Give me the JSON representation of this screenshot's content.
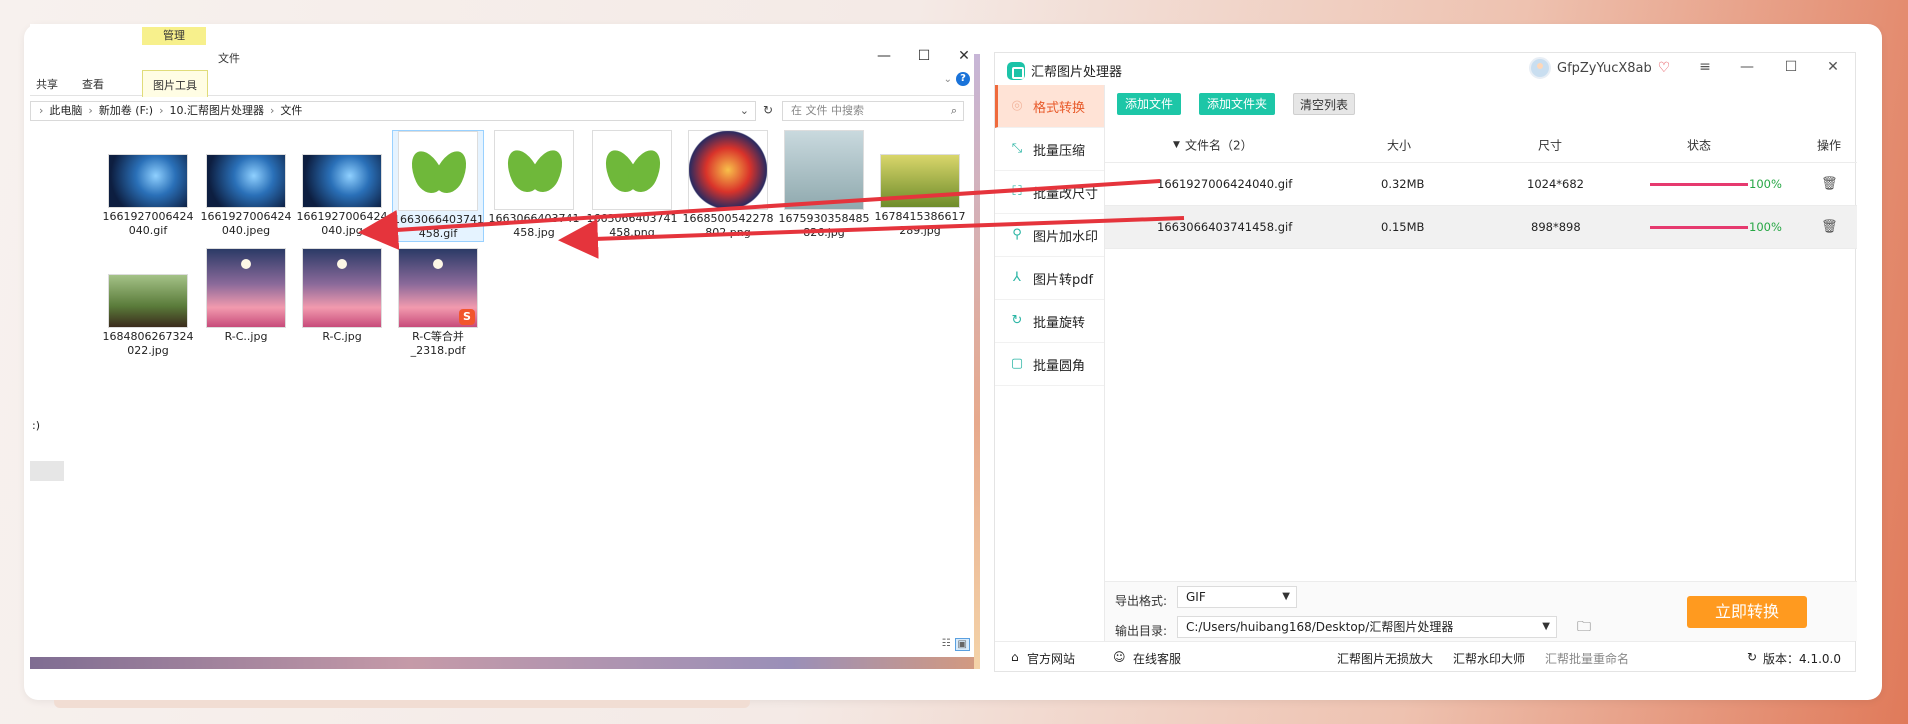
{
  "explorer": {
    "context_tab": "管理",
    "file_tab": "文件",
    "tabs": [
      "共享",
      "查看",
      "图片工具"
    ],
    "window_controls": [
      "—",
      "☐",
      "✕"
    ],
    "breadcrumb": [
      "此电脑",
      "新加卷 (F:)",
      "10.汇帮图片处理器",
      "文件"
    ],
    "search_placeholder": "在 文件 中搜索",
    "files_row1": [
      {
        "name": "1661927006424\n040.gif",
        "thumb": "blue"
      },
      {
        "name": "1661927006424\n040.jpeg",
        "thumb": "blue"
      },
      {
        "name": "1661927006424\n040.jpg",
        "thumb": "blue"
      },
      {
        "name": "1663066403741\n458.gif",
        "thumb": "leaf"
      },
      {
        "name": "1663066403741\n458.jpg",
        "thumb": "leaf"
      },
      {
        "name": "1663066403741\n458.png",
        "thumb": "leaf"
      },
      {
        "name": "1668500542278\n802.png",
        "thumb": "dragon"
      },
      {
        "name": "1675930358485\n826.jpg",
        "thumb": "cloud"
      },
      {
        "name": "1678415386617\n289.jpg",
        "thumb": "field"
      }
    ],
    "files_row2": [
      {
        "name": "1684806267324\n022.jpg",
        "thumb": "food"
      },
      {
        "name": "R-C..jpg",
        "thumb": "moon"
      },
      {
        "name": "R-C.jpg",
        "thumb": "moon"
      },
      {
        "name": "R-C等合并\n_2318.pdf",
        "thumb": "moon-pdf"
      }
    ],
    "side_fragment": ":)"
  },
  "app": {
    "title": "汇帮图片处理器",
    "username": "GfpZyYucX8ab",
    "controls": [
      "≡",
      "—",
      "☐",
      "✕"
    ],
    "sidebar": [
      {
        "label": "格式转换",
        "icon": "format-convert-icon"
      },
      {
        "label": "批量压缩",
        "icon": "compress-icon"
      },
      {
        "label": "批量改尺寸",
        "icon": "resize-icon"
      },
      {
        "label": "图片加水印",
        "icon": "watermark-icon"
      },
      {
        "label": "图片转pdf",
        "icon": "pdf-icon"
      },
      {
        "label": "批量旋转",
        "icon": "rotate-icon"
      },
      {
        "label": "批量圆角",
        "icon": "round-corner-icon"
      }
    ],
    "toolbar": {
      "add_file": "添加文件",
      "add_folder": "添加文件夹",
      "clear_list": "清空列表"
    },
    "table": {
      "headers": {
        "name": "文件名（2）",
        "size": "大小",
        "dims": "尺寸",
        "status": "状态",
        "action": "操作"
      },
      "rows": [
        {
          "name": "1661927006424040.gif",
          "size": "0.32MB",
          "dims": "1024*682",
          "progress": 1.0,
          "pct": "100%"
        },
        {
          "name": "1663066403741458.gif",
          "size": "0.15MB",
          "dims": "898*898",
          "progress": 1.0,
          "pct": "100%"
        }
      ]
    },
    "export_format_label": "导出格式:",
    "export_format_value": "GIF",
    "output_dir_label": "输出目录:",
    "output_dir_value": "C:/Users/huibang168/Desktop/汇帮图片处理器",
    "convert_button": "立即转换",
    "footer": {
      "website": "官方网站",
      "support": "在线客服",
      "link1": "汇帮图片无损放大",
      "link2": "汇帮水印大师",
      "link3": "汇帮批量重命名",
      "version": "版本：4.1.0.0"
    }
  },
  "colors": {
    "accent_teal": "#1dc6a7",
    "accent_orange": "#ff9a1f",
    "active_sidebar_bg": "#ffe3d6",
    "progress_bar": "#e63a6f",
    "arrow_red": "#e5343c"
  }
}
